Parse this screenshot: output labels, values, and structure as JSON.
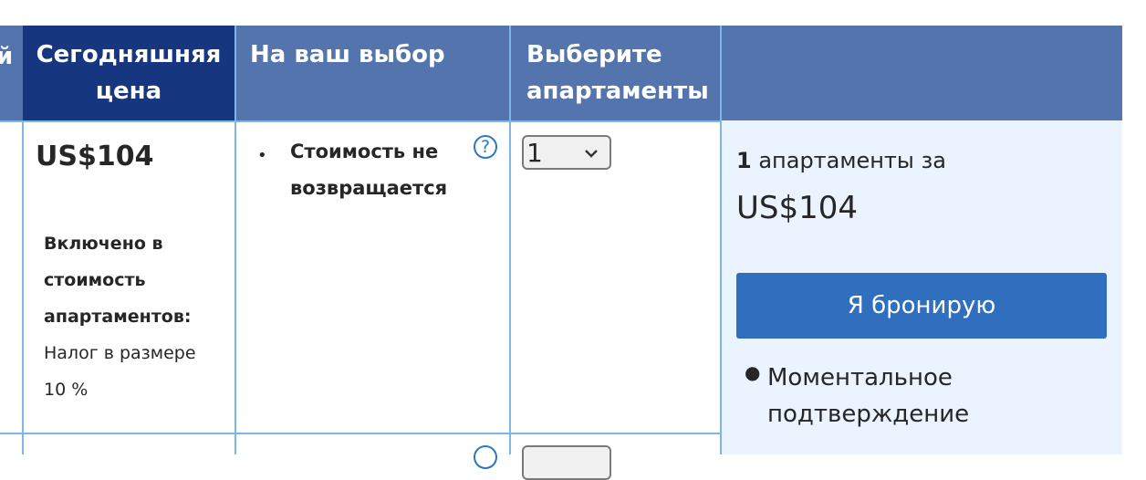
{
  "header": {
    "col_prev_fragment": "й",
    "col_price": "Сегодняшняя цена",
    "col_choice": "На ваш выбор",
    "col_select": "Выберите апартаменты",
    "col_summary": ""
  },
  "row": {
    "price": "US$104",
    "included_title": "Включено в стоимость апартаментов:",
    "tax_text": "Налог в размере 10 %",
    "condition": "Стоимость не возвращается",
    "help_icon": "?",
    "quantity_selected": "1",
    "quantity_options": [
      "1"
    ]
  },
  "summary": {
    "count": "1",
    "count_suffix": "апартаменты за",
    "total": "US$104",
    "book_button": "Я бронирую",
    "benefit": "Моментальное подтверждение"
  },
  "colors": {
    "header_bg": "#5474ae",
    "header_dark_bg": "#173680",
    "summary_bg": "#ebf3ff",
    "button_bg": "#2f6fbe",
    "border": "#7fb6e8"
  }
}
